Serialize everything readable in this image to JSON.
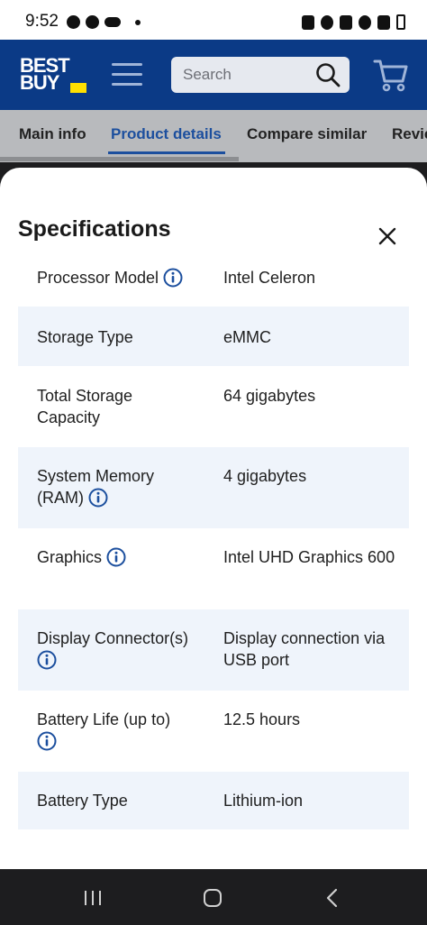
{
  "status_bar": {
    "time": "9:52"
  },
  "header": {
    "logo_line1": "BEST",
    "logo_line2": "BUY",
    "search_placeholder": "Search",
    "colors": {
      "brand_blue": "#0b3a86",
      "logo_tag": "#ffe000"
    }
  },
  "tabs": [
    {
      "label": "Main info",
      "active": false
    },
    {
      "label": "Product details",
      "active": true
    },
    {
      "label": "Compare similar",
      "active": false
    },
    {
      "label": "Revie",
      "active": false
    }
  ],
  "sheet": {
    "title": "Specifications",
    "specs": [
      {
        "label": "Processor Model",
        "value": "Intel Celeron",
        "info": true
      },
      {
        "label": "Storage Type",
        "value": "eMMC",
        "info": false
      },
      {
        "label": "Total Storage Capacity",
        "value": "64 gigabytes",
        "info": false
      },
      {
        "label": "System Memory (RAM)",
        "value": "4 gigabytes",
        "info": true
      },
      {
        "label": "Graphics",
        "value": "Intel UHD Graphics 600",
        "info": true
      },
      {
        "label": "Display Connector(s)",
        "value": "Display connection via USB port",
        "info": true
      },
      {
        "label": "Battery Life (up to)",
        "value": "12.5 hours",
        "info": true
      },
      {
        "label": "Battery Type",
        "value": "Lithium-ion",
        "info": false
      }
    ]
  },
  "colors": {
    "accent": "#1c4f9e",
    "row_shade": "#eff4fb"
  }
}
